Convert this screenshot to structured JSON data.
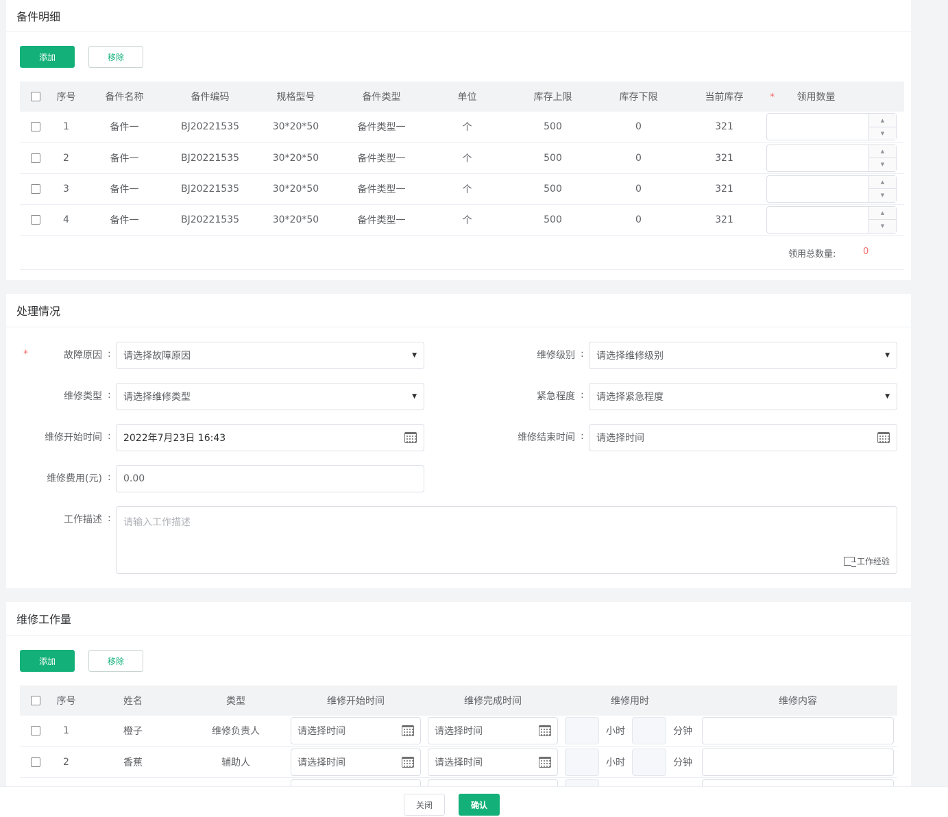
{
  "spare_parts": {
    "title": "备件明细",
    "add_label": "添加",
    "remove_label": "移除",
    "columns": [
      "序号",
      "备件名称",
      "备件编码",
      "规格型号",
      "备件类型",
      "单位",
      "库存上限",
      "库存下限",
      "当前库存",
      "领用数量"
    ],
    "required_mark": "*",
    "rows": [
      {
        "index": "1",
        "name": "备件一",
        "code": "BJ20221535",
        "spec": "30*20*50",
        "type": "备件类型一",
        "unit": "个",
        "max": "500",
        "min": "0",
        "current": "321"
      },
      {
        "index": "2",
        "name": "备件一",
        "code": "BJ20221535",
        "spec": "30*20*50",
        "type": "备件类型一",
        "unit": "个",
        "max": "500",
        "min": "0",
        "current": "321"
      },
      {
        "index": "3",
        "name": "备件一",
        "code": "BJ20221535",
        "spec": "30*20*50",
        "type": "备件类型一",
        "unit": "个",
        "max": "500",
        "min": "0",
        "current": "321"
      },
      {
        "index": "4",
        "name": "备件一",
        "code": "BJ20221535",
        "spec": "30*20*50",
        "type": "备件类型一",
        "unit": "个",
        "max": "500",
        "min": "0",
        "current": "321"
      }
    ],
    "total_label": "领用总数量:",
    "total_value": "0"
  },
  "handling": {
    "title": "处理情况",
    "required_mark": "*",
    "fault_reason_label": "故障原因",
    "fault_reason_placeholder": "请选择故障原因",
    "repair_level_label": "维修级别",
    "repair_level_placeholder": "请选择维修级别",
    "repair_type_label": "维修类型",
    "repair_type_placeholder": "请选择维修类型",
    "urgency_label": "紧急程度",
    "urgency_placeholder": "请选择紧急程度",
    "start_time_label": "维修开始时间",
    "start_time_value": "2022年7月23日 16:43",
    "end_time_label": "维修结束时间",
    "end_time_placeholder": "请选择时间",
    "cost_label": "维修费用(元)",
    "cost_value": "0.00",
    "desc_label": "工作描述",
    "desc_placeholder": "请输入工作描述",
    "experience_label": "工作经验",
    "colon": ":"
  },
  "workload": {
    "title": "维修工作量",
    "add_label": "添加",
    "remove_label": "移除",
    "columns": [
      "序号",
      "姓名",
      "类型",
      "维修开始时间",
      "维修完成时间",
      "维修用时",
      "维修内容"
    ],
    "time_placeholder": "请选择时间",
    "hour_label": "小时",
    "minute_label": "分钟",
    "rows": [
      {
        "index": "1",
        "name": "橙子",
        "type": "维修负责人"
      },
      {
        "index": "2",
        "name": "香蕉",
        "type": "辅助人"
      }
    ]
  },
  "footer": {
    "close_label": "关闭",
    "confirm_label": "确认"
  },
  "colors": {
    "primary": "#13b07a",
    "required": "#f56c6c"
  }
}
